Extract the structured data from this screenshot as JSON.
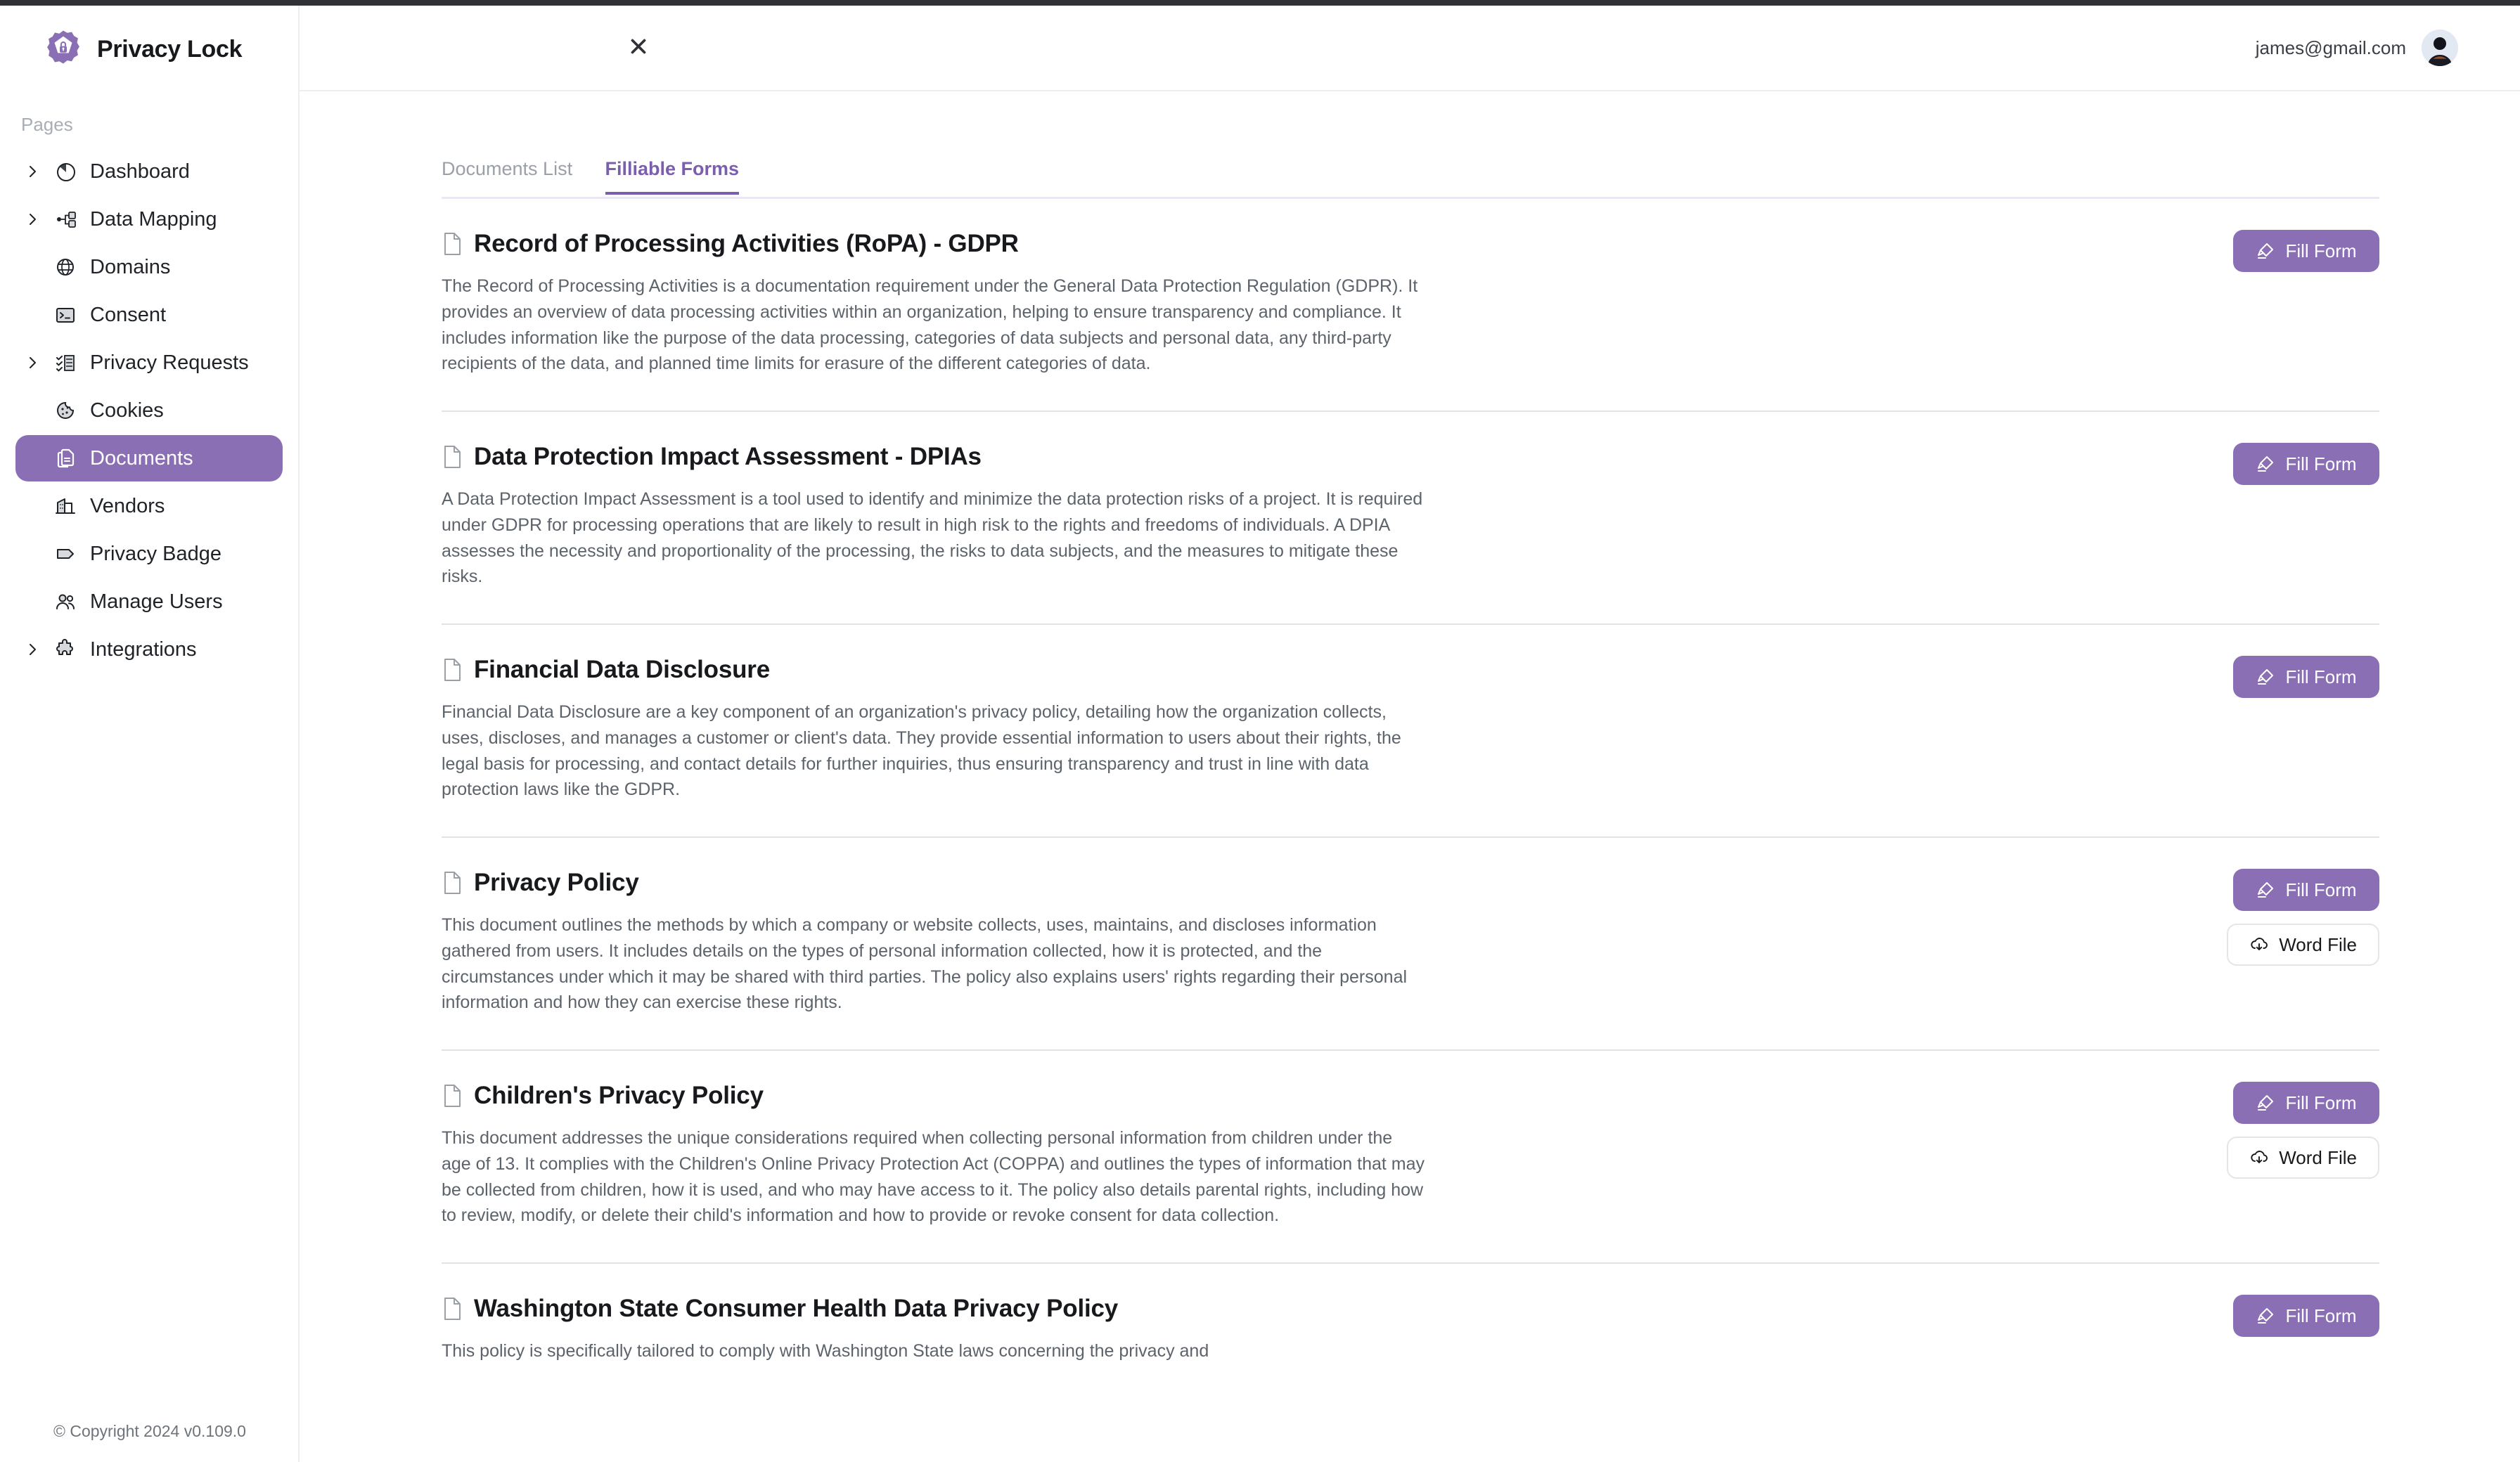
{
  "brand": {
    "name": "Privacy Lock",
    "logo_icon": "privacy-lock-badge-icon",
    "accent_color": "#8a6fb5"
  },
  "sidebar": {
    "section_label": "Pages",
    "items": [
      {
        "label": "Dashboard",
        "icon": "pie-chart-icon",
        "expandable": true,
        "active": false
      },
      {
        "label": "Data Mapping",
        "icon": "node-tree-icon",
        "expandable": true,
        "active": false
      },
      {
        "label": "Domains",
        "icon": "globe-icon",
        "expandable": false,
        "active": false
      },
      {
        "label": "Consent",
        "icon": "terminal-icon",
        "expandable": false,
        "active": false
      },
      {
        "label": "Privacy Requests",
        "icon": "checklist-icon",
        "expandable": true,
        "active": false
      },
      {
        "label": "Cookies",
        "icon": "cookie-icon",
        "expandable": false,
        "active": false
      },
      {
        "label": "Documents",
        "icon": "documents-icon",
        "expandable": false,
        "active": true
      },
      {
        "label": "Vendors",
        "icon": "building-icon",
        "expandable": false,
        "active": false
      },
      {
        "label": "Privacy Badge",
        "icon": "tag-icon",
        "expandable": false,
        "active": false
      },
      {
        "label": "Manage Users",
        "icon": "users-icon",
        "expandable": false,
        "active": false
      },
      {
        "label": "Integrations",
        "icon": "puzzle-piece-icon",
        "expandable": true,
        "active": false
      }
    ],
    "footer": "© Copyright 2024 v0.109.0"
  },
  "header": {
    "close_icon": "close-icon",
    "user_email": "james@gmail.com",
    "avatar_icon": "avatar-icon"
  },
  "main": {
    "tabs": [
      {
        "label": "Documents List",
        "active": false
      },
      {
        "label": "Filliable Forms",
        "active": true
      }
    ],
    "buttons": {
      "fill_form_label": "Fill Form",
      "fill_form_icon": "highlighter-icon",
      "word_file_label": "Word File",
      "word_file_icon": "cloud-download-icon"
    },
    "documents": [
      {
        "title": "Record of Processing Activities (RoPA) - GDPR",
        "description": "The Record of Processing Activities is a documentation requirement under the General Data Protection Regulation (GDPR). It provides an overview of data processing activities within an organization, helping to ensure transparency and compliance. It includes information like the purpose of the data processing, categories of data subjects and personal data, any third-party recipients of the data, and planned time limits for erasure of the different categories of data.",
        "has_fill_form": true,
        "has_word_file": false
      },
      {
        "title": "Data Protection Impact Assessment - DPIAs",
        "description": "A Data Protection Impact Assessment is a tool used to identify and minimize the data protection risks of a project. It is required under GDPR for processing operations that are likely to result in high risk to the rights and freedoms of individuals. A DPIA assesses the necessity and proportionality of the processing, the risks to data subjects, and the measures to mitigate these risks.",
        "has_fill_form": true,
        "has_word_file": false
      },
      {
        "title": "Financial Data Disclosure",
        "description": "Financial Data Disclosure are a key component of an organization's privacy policy, detailing how the organization collects, uses, discloses, and manages a customer or client's data. They provide essential information to users about their rights, the legal basis for processing, and contact details for further inquiries, thus ensuring transparency and trust in line with data protection laws like the GDPR.",
        "has_fill_form": true,
        "has_word_file": false
      },
      {
        "title": "Privacy Policy",
        "description": "This document outlines the methods by which a company or website collects, uses, maintains, and discloses information gathered from users. It includes details on the types of personal information collected, how it is protected, and the circumstances under which it may be shared with third parties. The policy also explains users' rights regarding their personal information and how they can exercise these rights.",
        "has_fill_form": true,
        "has_word_file": true
      },
      {
        "title": "Children's Privacy Policy",
        "description": "This document addresses the unique considerations required when collecting personal information from children under the age of 13. It complies with the Children's Online Privacy Protection Act (COPPA) and outlines the types of information that may be collected from children, how it is used, and who may have access to it. The policy also details parental rights, including how to review, modify, or delete their child's information and how to provide or revoke consent for data collection.",
        "has_fill_form": true,
        "has_word_file": true
      },
      {
        "title": "Washington State Consumer Health Data Privacy Policy",
        "description": "This policy is specifically tailored to comply with Washington State laws concerning the privacy and",
        "has_fill_form": true,
        "has_word_file": false
      }
    ]
  }
}
